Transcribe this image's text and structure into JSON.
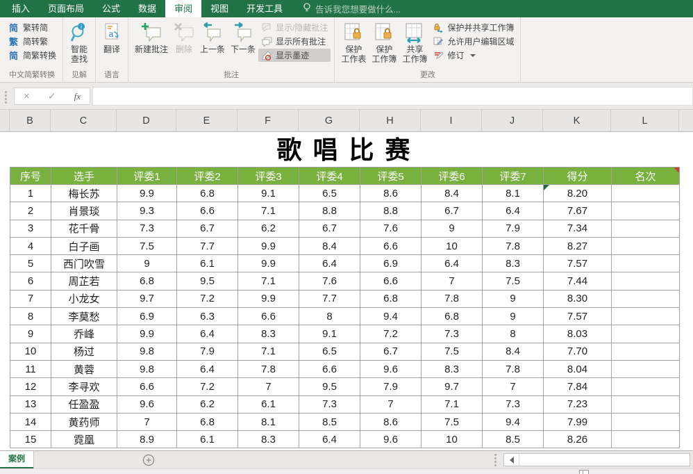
{
  "ribbon": {
    "tabs": [
      "插入",
      "页面布局",
      "公式",
      "数据",
      "审阅",
      "视图",
      "开发工具"
    ],
    "active_tab": "审阅",
    "tell_me": "告诉我您想要做什么...",
    "groups": {
      "conversion": {
        "label": "中文简繁转换",
        "items": [
          {
            "label": "繁转简",
            "icon_glyph": "简"
          },
          {
            "label": "简转繁",
            "icon_glyph": "繁"
          },
          {
            "label": "简繁转换",
            "icon_glyph": "简"
          }
        ]
      },
      "insights": {
        "label": "见解",
        "smart_lookup": "智能\n查找"
      },
      "language": {
        "label": "语言",
        "translate": "翻译"
      },
      "comments": {
        "label": "批注",
        "new_comment": "新建批注",
        "delete_comment": "删除",
        "previous": "上一条",
        "next": "下一条",
        "show_hide": "显示/隐藏批注",
        "show_all": "显示所有批注",
        "show_ink": "显示墨迹"
      },
      "changes": {
        "label": "更改",
        "protect_sheet": "保护\n工作表",
        "protect_workbook": "保护\n工作簿",
        "share_workbook": "共享\n工作簿",
        "protect_share": "保护并共享工作簿",
        "allow_edit": "允许用户编辑区域",
        "track": "修订"
      }
    }
  },
  "formula_bar": {
    "cancel": "×",
    "enter": "✓",
    "fx": "fx",
    "value": ""
  },
  "grid": {
    "column_letters": [
      "B",
      "C",
      "D",
      "E",
      "F",
      "G",
      "H",
      "I",
      "J",
      "K",
      "L"
    ]
  },
  "sheet": {
    "title": "歌 唱 比 赛",
    "table": {
      "headers": [
        "序号",
        "选手",
        "评委1",
        "评委2",
        "评委3",
        "评委4",
        "评委5",
        "评委6",
        "评委7",
        "得分",
        "名次"
      ],
      "comment_marker_header": "名次",
      "rows": [
        {
          "no": "1",
          "name": "梅长苏",
          "scores": [
            "9.9",
            "6.8",
            "9.1",
            "6.5",
            "8.6",
            "8.4",
            "8.1"
          ],
          "score": "8.20",
          "rank": ""
        },
        {
          "no": "2",
          "name": "肖景琰",
          "scores": [
            "9.3",
            "6.6",
            "7.1",
            "8.8",
            "8.8",
            "6.7",
            "6.4"
          ],
          "score": "7.67",
          "rank": ""
        },
        {
          "no": "3",
          "name": "花千骨",
          "scores": [
            "7.3",
            "6.7",
            "6.2",
            "6.7",
            "7.6",
            "9",
            "7.9"
          ],
          "score": "7.34",
          "rank": ""
        },
        {
          "no": "4",
          "name": "白子画",
          "scores": [
            "7.5",
            "7.7",
            "9.9",
            "8.4",
            "6.6",
            "10",
            "7.8"
          ],
          "score": "8.27",
          "rank": ""
        },
        {
          "no": "5",
          "name": "西门吹雪",
          "scores": [
            "9",
            "6.1",
            "9.9",
            "6.4",
            "6.9",
            "6.4",
            "8.3"
          ],
          "score": "7.57",
          "rank": ""
        },
        {
          "no": "6",
          "name": "周芷若",
          "scores": [
            "6.8",
            "9.5",
            "7.1",
            "7.6",
            "6.6",
            "7",
            "7.5"
          ],
          "score": "7.44",
          "rank": ""
        },
        {
          "no": "7",
          "name": "小龙女",
          "scores": [
            "9.7",
            "7.2",
            "9.9",
            "7.7",
            "6.8",
            "7.8",
            "9"
          ],
          "score": "8.30",
          "rank": ""
        },
        {
          "no": "8",
          "name": "李莫愁",
          "scores": [
            "6.9",
            "6.3",
            "6.6",
            "8",
            "9.4",
            "6.8",
            "9"
          ],
          "score": "7.57",
          "rank": ""
        },
        {
          "no": "9",
          "name": "乔峰",
          "scores": [
            "9.9",
            "6.4",
            "8.3",
            "9.1",
            "7.2",
            "7.3",
            "8"
          ],
          "score": "8.03",
          "rank": ""
        },
        {
          "no": "10",
          "name": "杨过",
          "scores": [
            "9.8",
            "7.9",
            "7.1",
            "6.5",
            "6.7",
            "7.5",
            "8.4"
          ],
          "score": "7.70",
          "rank": ""
        },
        {
          "no": "11",
          "name": "黄蓉",
          "scores": [
            "9.8",
            "6.4",
            "7.8",
            "6.6",
            "9.6",
            "8.3",
            "7.8"
          ],
          "score": "8.04",
          "rank": ""
        },
        {
          "no": "12",
          "name": "李寻欢",
          "scores": [
            "6.6",
            "7.2",
            "7",
            "9.5",
            "7.9",
            "9.7",
            "7"
          ],
          "score": "7.84",
          "rank": ""
        },
        {
          "no": "13",
          "name": "任盈盈",
          "scores": [
            "9.6",
            "6.2",
            "6.1",
            "7.3",
            "7",
            "7.1",
            "7.3"
          ],
          "score": "7.23",
          "rank": ""
        },
        {
          "no": "14",
          "name": "黄药师",
          "scores": [
            "7",
            "6.8",
            "8.1",
            "8.5",
            "8.6",
            "7.5",
            "9.4"
          ],
          "score": "7.99",
          "rank": ""
        },
        {
          "no": "15",
          "name": "霓凰",
          "scores": [
            "8.9",
            "6.1",
            "8.3",
            "6.4",
            "9.6",
            "10",
            "8.5"
          ],
          "score": "8.26",
          "rank": ""
        }
      ]
    },
    "selected_cell": {
      "row_index": 0,
      "column": "得分",
      "value": "8.20"
    }
  },
  "bottom": {
    "sheet_tab": "案例"
  },
  "colors": {
    "ribbon_green": "#217346",
    "table_header_fill": "#79b13f",
    "selected_cell_fill": "#29b5e8"
  }
}
